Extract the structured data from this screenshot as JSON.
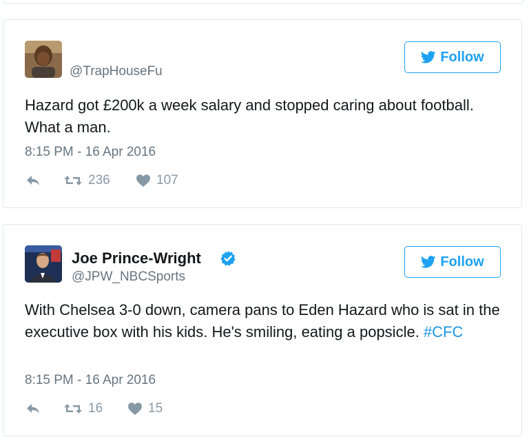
{
  "tweets": [
    {
      "display_name": "",
      "handle": "@TrapHouseFu",
      "follow_label": "Follow",
      "text": "Hazard got £200k a week salary and stopped caring about football. What a man.",
      "timestamp": "8:15 PM - 16 Apr 2016",
      "retweets": "236",
      "likes": "107",
      "verified": false
    },
    {
      "display_name": "Joe Prince-Wright",
      "handle": "@JPW_NBCSports",
      "follow_label": "Follow",
      "text_before": "With Chelsea 3-0 down, camera pans to Eden Hazard who is sat in the executive box with his kids. He's smiling, eating a popsicle. ",
      "hashtag": "#CFC",
      "timestamp": "8:15 PM - 16 Apr 2016",
      "retweets": "16",
      "likes": "15",
      "verified": true
    }
  ],
  "colors": {
    "accent": "#1da1f2",
    "hashtag": "#1b95e0",
    "muted": "#66757f",
    "icons": "#8899a6",
    "border": "#e1e8ed"
  },
  "icons": [
    "twitter-bird-icon",
    "reply-icon",
    "retweet-icon",
    "heart-icon",
    "verified-badge-icon"
  ]
}
